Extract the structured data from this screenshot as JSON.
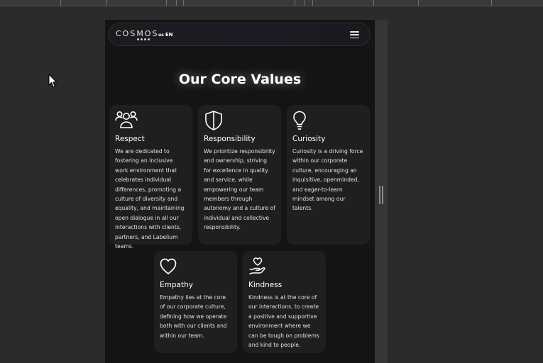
{
  "navbar": {
    "logo_text": "COSMOS",
    "language_region": "us",
    "language_code": "EN"
  },
  "section": {
    "title_prefix": "Our ",
    "title_bold": "Core",
    "title_suffix": " Values"
  },
  "values": [
    {
      "icon": "people-icon",
      "title": "Respect",
      "text": "We are dedicated to fostering an inclusive work environment that celebrates individual differences, promoting a culture of diversity and equality, and maintaining open dialogue in all our interactions with clients, partners, and Labelium teams."
    },
    {
      "icon": "shield-icon",
      "title": "Responsibility",
      "text": "We prioritize responsibility and ownership, striving for excellence in quality and service, while empowering our team members through autonomy and a culture of individual and collective responsibility."
    },
    {
      "icon": "lightbulb-icon",
      "title": "Curiosity",
      "text": "Curiosity is a driving force within our corporate culture, encouraging an inquisitive, openminded, and eager-to-learn mindset among our talents."
    },
    {
      "icon": "heart-icon",
      "title": "Empathy",
      "text": "Empathy lies at the core of our corporate culture, defining how we operate both with our clients and within our team."
    },
    {
      "icon": "heart-hand-icon",
      "title": "Kindness",
      "text": "Kindness is at the core of our interactions, to create a positive and supportive environment where we can be tough on problems and kind to people."
    }
  ],
  "colors": {
    "page_background": "#141414",
    "card_background": "#1f1f1f",
    "text": "#ffffff",
    "editor_background": "#2b2b2b"
  }
}
